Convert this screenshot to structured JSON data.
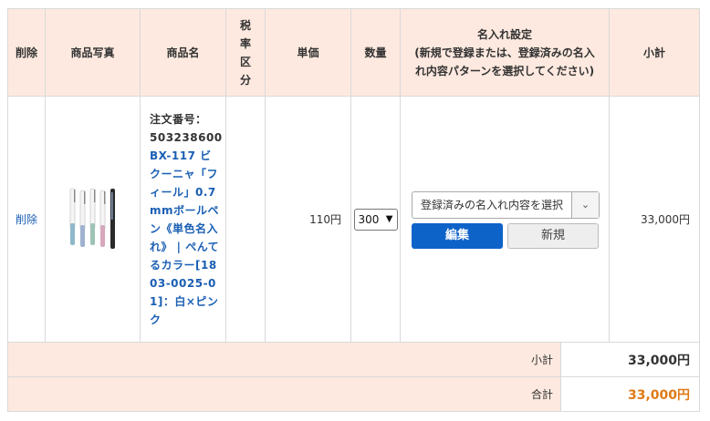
{
  "headers": {
    "delete": "削除",
    "photo": "商品写真",
    "name": "商品名",
    "tax_line1": "税",
    "tax_line2": "率",
    "tax_line3": "区",
    "tax_line4": "分",
    "unit_price": "単価",
    "quantity": "数量",
    "name_setting_title": "名入れ設定",
    "name_setting_line2": "(新規で登録または、登録済みの名入",
    "name_setting_line3": "れ内容パターンを選択してください)",
    "subtotal": "小計"
  },
  "item": {
    "delete_label": "削除",
    "photo_alt": "pen-set-photo",
    "order_label": "注文番号：",
    "order_number": "503238600",
    "product_name": "BX-117 ビクーニャ「フィール」0.7mmボールペン《単色名入れ》 | ぺんてるカラー[1803-0025-01]：白×ピンク",
    "tax_category": "",
    "unit_price": "110円",
    "quantity": "300",
    "pattern_select": "登録済みの名入れ内容を選択",
    "edit_button": "編集",
    "new_button": "新規",
    "subtotal": "33,000円"
  },
  "summary": {
    "subtotal_label": "小計",
    "subtotal_value": "33,000円",
    "total_label": "合計",
    "total_value": "33,000円",
    "total_color": "#e07a16"
  },
  "colors": {
    "header_bg": "#fde9df",
    "link": "#1a5fb4",
    "edit_button_bg": "#0e63c9"
  }
}
